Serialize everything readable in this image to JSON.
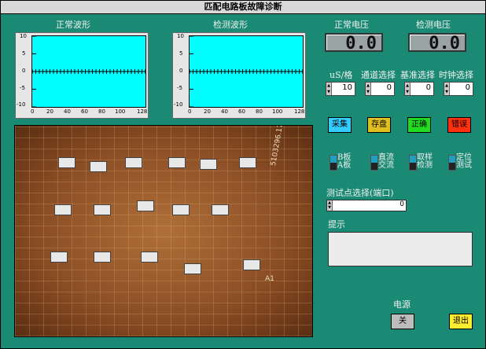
{
  "window": {
    "title": "匹配电路板故障诊断"
  },
  "normal_waveform": {
    "label": "正常波形",
    "yticks": [
      "10",
      "5",
      "0",
      "-5",
      "-10"
    ],
    "xticks": [
      "0",
      "20",
      "40",
      "60",
      "80",
      "100",
      "128"
    ]
  },
  "test_waveform": {
    "label": "检测波形",
    "yticks": [
      "10",
      "5",
      "0",
      "-5",
      "-10"
    ],
    "xticks": [
      "0",
      "20",
      "40",
      "60",
      "80",
      "100",
      "128"
    ]
  },
  "normal_voltage": {
    "label": "正常电压",
    "value": "0.0"
  },
  "test_voltage": {
    "label": "检测电压",
    "value": "0.0"
  },
  "controls": {
    "us_per_div": {
      "label": "uS/格",
      "value": "10"
    },
    "channel": {
      "label": "通道选择",
      "value": "0"
    },
    "reference": {
      "label": "基准选择",
      "value": "0"
    },
    "clock": {
      "label": "时钟选择",
      "value": "0"
    }
  },
  "buttons": {
    "acquire": {
      "label": "采集",
      "color": "#33ccff"
    },
    "save": {
      "label": "存盘",
      "color": "#e0c020"
    },
    "correct": {
      "label": "正确",
      "color": "#20dd20"
    },
    "error": {
      "label": "错误",
      "color": "#ff3010"
    },
    "power": {
      "label": "关",
      "color": "#bcbcbc"
    },
    "exit": {
      "label": "退出",
      "color": "#ffee30"
    }
  },
  "toggles": {
    "board": {
      "top": "B板",
      "bottom": "A板"
    },
    "dc_ac": {
      "top": "直流",
      "bottom": "交流"
    },
    "sample": {
      "top": "取样",
      "bottom": "检测"
    },
    "position": {
      "top": "定位",
      "bottom": "测试"
    }
  },
  "test_point": {
    "label": "测试点选择(端口)",
    "value": "0"
  },
  "hint": {
    "label": "提示",
    "text": ""
  },
  "power_label": "电源",
  "board_marking": {
    "serial": "5103296.172",
    "tag": "A1"
  }
}
